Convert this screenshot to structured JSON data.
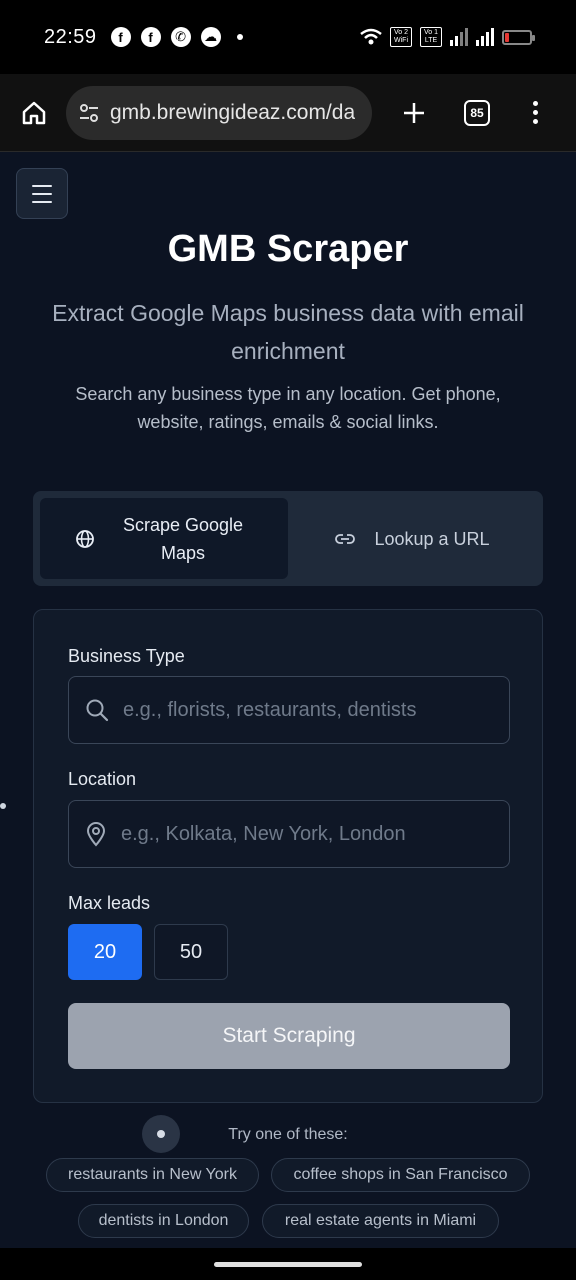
{
  "status_bar": {
    "time": "22:59",
    "notification_icons": [
      "facebook-icon",
      "facebook-icon",
      "whatsapp-icon",
      "chat-icon"
    ],
    "net_badge_1": "Vo 2 WiFi",
    "net_badge_2": "Vo 1 LTE",
    "battery_level": 0.18,
    "battery_color": "#e53935"
  },
  "browser": {
    "url": "gmb.brewingideaz.com/da",
    "tab_count": "85"
  },
  "page": {
    "title": "GMB Scraper",
    "subtitle": "Extract Google Maps business data with email enrichment",
    "description": "Search any business type in any location. Get phone, website, ratings, emails & social links.",
    "tabs": [
      {
        "label": "Scrape Google Maps",
        "icon": "globe-icon",
        "active": true
      },
      {
        "label": "Lookup a URL",
        "icon": "link-icon",
        "active": false
      }
    ],
    "form": {
      "business_type_label": "Business Type",
      "business_type_placeholder": "e.g., florists, restaurants, dentists",
      "location_label": "Location",
      "location_placeholder": "e.g., Kolkata, New York, London",
      "max_leads_label": "Max leads",
      "max_leads_options": [
        "20",
        "50"
      ],
      "max_leads_selected": "20",
      "start_button": "Start Scraping"
    },
    "try_label": "Try one of these:",
    "suggestions": [
      "restaurants in New York",
      "coffee shops in San Francisco",
      "dentists in London",
      "real estate agents in Miami"
    ]
  },
  "colors": {
    "accent": "#1e6cf2",
    "background": "#0c1322",
    "card": "#111a29",
    "disabled_button": "#9ca3af"
  }
}
